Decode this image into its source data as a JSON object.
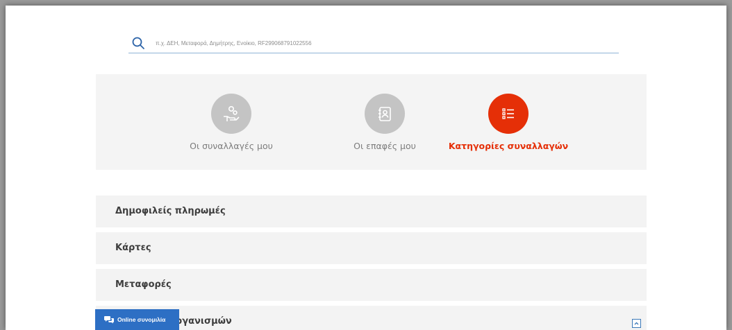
{
  "search": {
    "placeholder": "π.χ. ΔΕΗ, Μεταφορά, Δημήτρης, Ενοίκιο, RF299068791022556",
    "icon": "search-icon"
  },
  "tabs": [
    {
      "label": "Οι συναλλαγές μου",
      "icon": "hand-coins-icon",
      "active": false
    },
    {
      "label": "Οι επαφές μου",
      "icon": "contacts-book-icon",
      "active": false
    },
    {
      "label": "Κατηγορίες συναλλαγών",
      "icon": "list-icon",
      "active": true
    }
  ],
  "categories": [
    {
      "label": "Δημοφιλείς πληρωμές"
    },
    {
      "label": "Κάρτες"
    },
    {
      "label": "Μεταφορές"
    },
    {
      "label": "Πληρωμές οργανισμών"
    }
  ],
  "chat": {
    "label": "Online συνομιλία",
    "icon": "chat-bubbles-icon"
  },
  "colors": {
    "accent": "#e52f07",
    "chat": "#2d6fc4",
    "inactive_icon": "#c4c4c4"
  }
}
